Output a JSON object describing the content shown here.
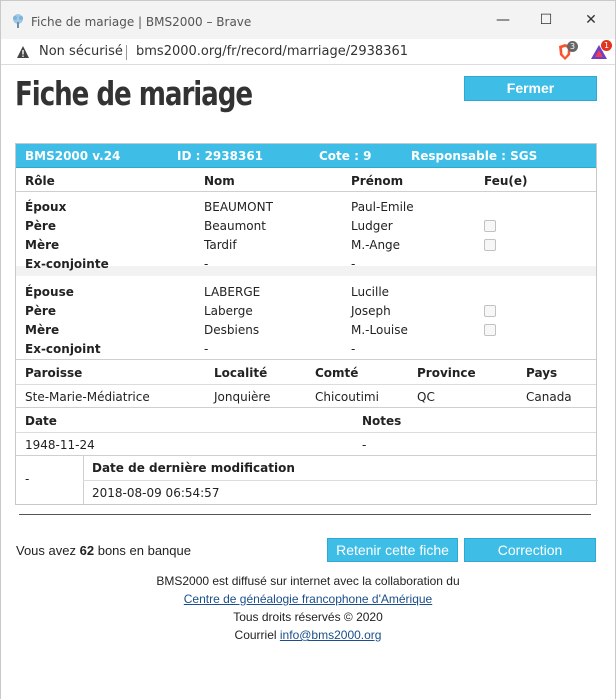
{
  "window": {
    "title": "Fiche de mariage | BMS2000 – Brave",
    "minimize_glyph": "—",
    "maximize_glyph": "☐",
    "close_glyph": "✕"
  },
  "addressbar": {
    "security_label": "Non sécurisé",
    "url": "bms2000.org/fr/record/marriage/2938361",
    "shield_badge": "3",
    "rewards_badge": "1"
  },
  "page": {
    "title": "Fiche de mariage",
    "close_label": "Fermer"
  },
  "record_header": {
    "version": "BMS2000 v.24",
    "id": "ID : 2938361",
    "cote": "Cote : 9",
    "responsable": "Responsable : SGS"
  },
  "persons_columns": [
    "Rôle",
    "Nom",
    "Prénom",
    "Feu(e)"
  ],
  "groom_group": [
    {
      "role": "Époux",
      "nom": "BEAUMONT",
      "prenom": "Paul-Emile",
      "feu": false,
      "has_checkbox": false
    },
    {
      "role": "Père",
      "nom": "Beaumont",
      "prenom": "Ludger",
      "feu": false,
      "has_checkbox": true
    },
    {
      "role": "Mère",
      "nom": "Tardif",
      "prenom": "M.-Ange",
      "feu": false,
      "has_checkbox": true
    },
    {
      "role": "Ex-conjointe",
      "nom": "-",
      "prenom": "-",
      "feu": false,
      "has_checkbox": false
    }
  ],
  "bride_group": [
    {
      "role": "Épouse",
      "nom": "LABERGE",
      "prenom": "Lucille",
      "feu": false,
      "has_checkbox": false
    },
    {
      "role": "Père",
      "nom": "Laberge",
      "prenom": "Joseph",
      "feu": false,
      "has_checkbox": true
    },
    {
      "role": "Mère",
      "nom": "Desbiens",
      "prenom": "M.-Louise",
      "feu": false,
      "has_checkbox": true
    },
    {
      "role": "Ex-conjoint",
      "nom": "-",
      "prenom": "-",
      "feu": false,
      "has_checkbox": false
    }
  ],
  "place": {
    "headers": {
      "paroisse": "Paroisse",
      "localite": "Localité",
      "comte": "Comté",
      "province": "Province",
      "pays": "Pays"
    },
    "values": {
      "paroisse": "Ste-Marie-Médiatrice",
      "localite": "Jonquière",
      "comte": "Chicoutimi",
      "province": "QC",
      "pays": "Canada"
    }
  },
  "dates": {
    "date_header": "Date",
    "notes_header": "Notes",
    "date_value": "1948-11-24",
    "notes_value": "-"
  },
  "modification": {
    "left_value": "-",
    "header": "Date de dernière modification",
    "value": "2018-08-09 06:54:57"
  },
  "bank": {
    "prefix": "Vous avez",
    "count": "62",
    "suffix": "bons en banque"
  },
  "actions": {
    "retain_label": "Retenir cette fiche",
    "correct_label": "Correction"
  },
  "footer": {
    "line1": "BMS2000 est diffusé sur internet avec la collaboration du",
    "link1": "Centre de généalogie francophone d'Amérique",
    "line3": "Tous droits réservés © 2020",
    "line4_prefix": "Courriel",
    "email": "info@bms2000.org"
  },
  "colors": {
    "accent": "#3ebde6",
    "link": "#1a4f8b"
  }
}
